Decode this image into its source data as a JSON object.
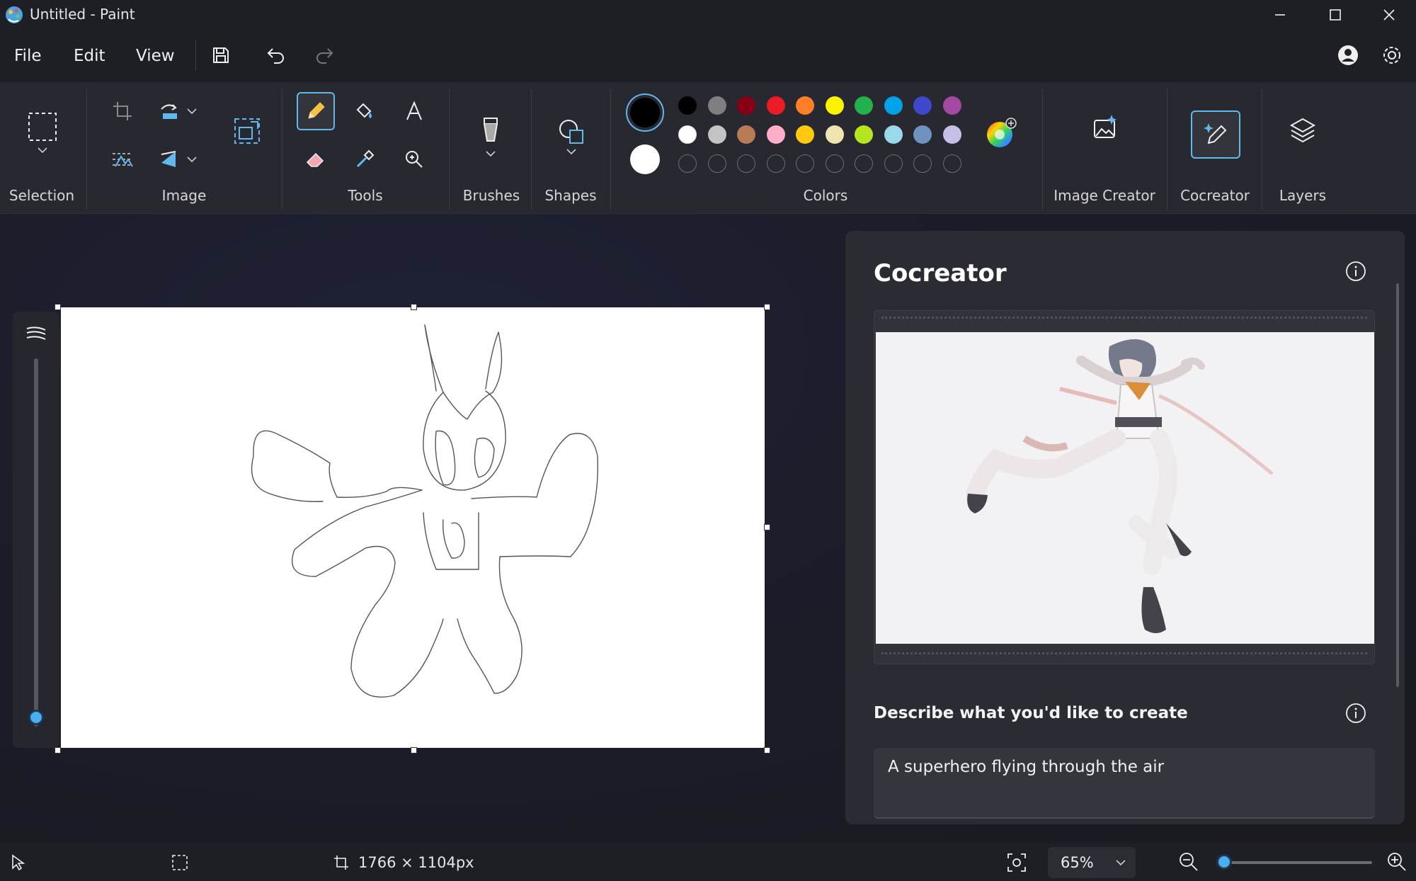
{
  "window": {
    "title": "Untitled - Paint",
    "controls": [
      "minimize",
      "maximize",
      "close"
    ]
  },
  "menu": {
    "file": "File",
    "edit": "Edit",
    "view": "View"
  },
  "ribbon": {
    "groups": {
      "selection": "Selection",
      "image": "Image",
      "tools": "Tools",
      "brushes": "Brushes",
      "shapes": "Shapes",
      "colors": "Colors",
      "image_creator": "Image Creator",
      "cocreator": "Cocreator",
      "layers": "Layers"
    },
    "active_tool": "pencil",
    "primary_color": "#000000",
    "secondary_color": "#ffffff",
    "palette_row1": [
      "#000000",
      "#7f7f7f",
      "#880015",
      "#ed1c24",
      "#ff7f27",
      "#fff200",
      "#22b14c",
      "#00a2e8",
      "#3f48cc",
      "#a349a4"
    ],
    "palette_row2": [
      "#ffffff",
      "#c3c3c3",
      "#b97a57",
      "#ffaec9",
      "#ffc90e",
      "#efe4b0",
      "#b5e61d",
      "#99d9ea",
      "#7092be",
      "#c8bfe7"
    ],
    "custom_slots": 10
  },
  "cocreator": {
    "title": "Cocreator",
    "describe_label": "Describe what you'd like to create",
    "prompt_value": "A superhero flying through the air"
  },
  "status": {
    "canvas_size": "1766 × 1104px",
    "zoom": "65%",
    "zoom_level": 0.05
  },
  "colors": {
    "accent": "#60b8ec",
    "panel": "#2b2c33",
    "ribbon": "#272830"
  }
}
